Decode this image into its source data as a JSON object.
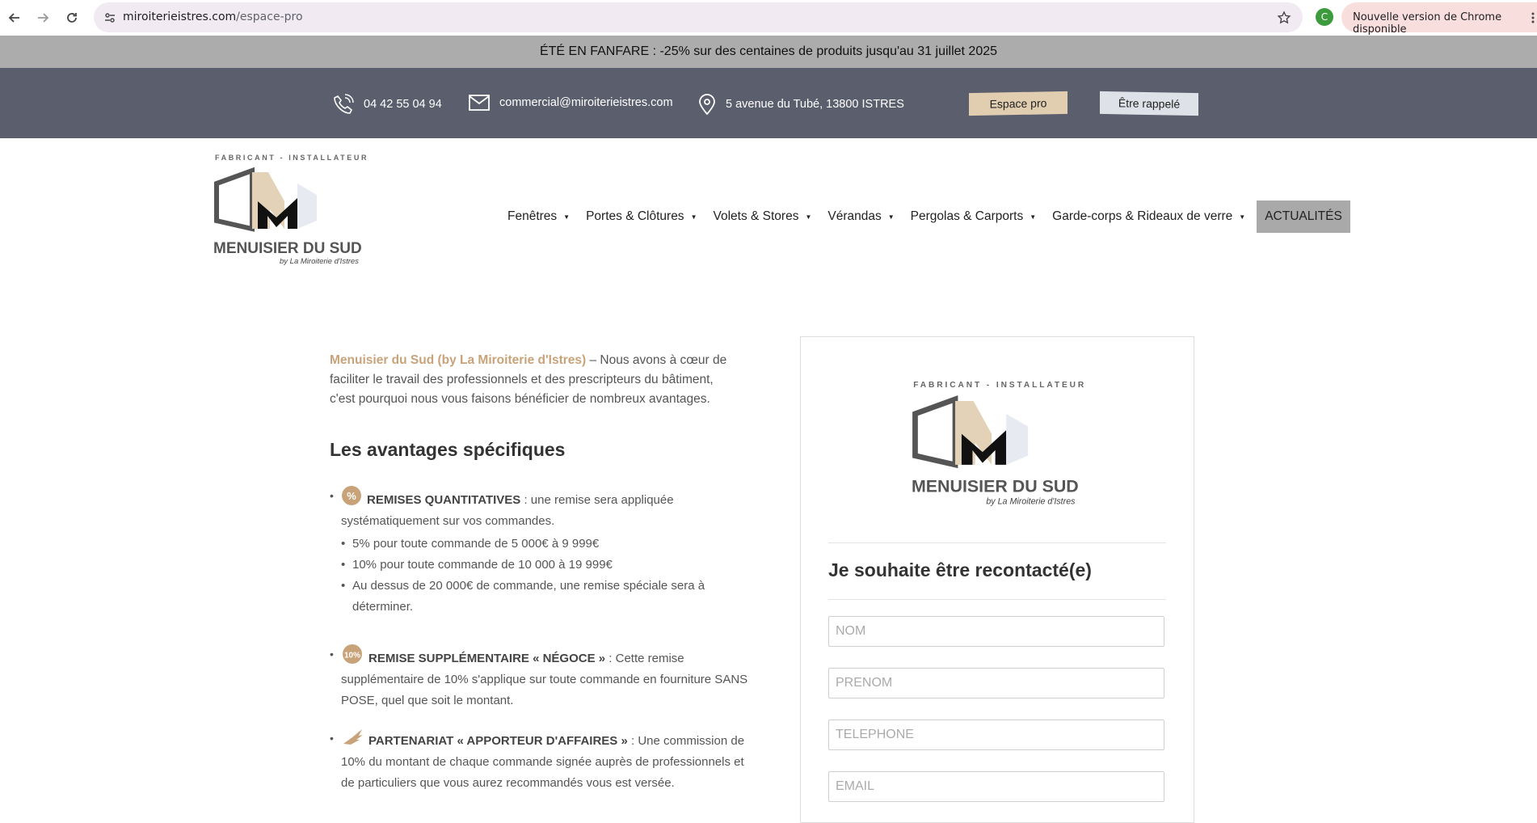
{
  "browser": {
    "url_domain": "miroiterieistres.com",
    "url_path": "/espace-pro",
    "profile_initial": "C",
    "update_label": "Nouvelle version de Chrome disponible"
  },
  "promo": {
    "text": "ÉTÉ EN FANFARE : -25% sur des centaines de produits jusqu'au 31 juillet 2025"
  },
  "contact": {
    "phone": "04 42 55 04 94",
    "email": "commercial@miroiterieistres.com",
    "address": "5 avenue du Tubé, 13800 ISTRES",
    "pro_button": "Espace pro",
    "callback_button": "Être rappelé"
  },
  "logo": {
    "tagline": "FABRICANT - INSTALLATEUR",
    "name": "MENUISIER DU SUD",
    "sub": "by La Miroiterie d'Istres"
  },
  "menu": {
    "items": [
      {
        "label": "Fenêtres"
      },
      {
        "label": "Portes & Clôtures"
      },
      {
        "label": "Volets & Stores"
      },
      {
        "label": "Vérandas"
      },
      {
        "label": "Pergolas & Carports"
      },
      {
        "label": "Garde-corps & Rideaux de verre"
      }
    ],
    "active": "ACTUALITÉS"
  },
  "intro": {
    "brand": "Menuisier du Sud (by La Miroiterie d'Istres)",
    "text": " – Nous avons à cœur de faciliter le travail des professionnels et des prescripteurs du bâtiment, c'est pourquoi nous vous faisons bénéficier de nombreux avantages."
  },
  "advantages": {
    "title": "Les avantages spécifiques",
    "items": [
      {
        "icon": "percent-badge-icon",
        "label": "REMISES QUANTITATIVES",
        "text": " : une remise sera appliquée systématiquement sur vos commandes.",
        "subs": [
          "5% pour toute commande de 5 000€ à 9 999€",
          "10% pour toute commande de 10 000 à 19 999€",
          "Au dessus de 20 000€ de commande, une remise spéciale sera à déterminer."
        ]
      },
      {
        "icon": "ten-percent-badge-icon",
        "badge_text": "10%",
        "label": "REMISE SUPPLÉMENTAIRE « NÉGOCE »",
        "text": " : Cette remise supplémentaire de 10% s'applique sur toute commande en fourniture SANS POSE, quel que soit le montant."
      },
      {
        "icon": "winged-foot-icon",
        "label": "PARTENARIAT « APPORTEUR D'AFFAIRES »",
        "text": " : Une commission de 10% du montant de chaque commande signée auprès de professionnels et de particuliers que vous aurez recommandés vous est versée."
      }
    ]
  },
  "form": {
    "title": "Je souhaite être recontacté(e)",
    "nom_placeholder": "NOM",
    "prenom_placeholder": "PRENOM",
    "tel_placeholder": "TELEPHONE",
    "email_placeholder": "EMAIL"
  },
  "colors": {
    "brand_gold": "#c8a37a",
    "contact_bar": "#5b5f6d",
    "promo_bar": "#acacac"
  }
}
